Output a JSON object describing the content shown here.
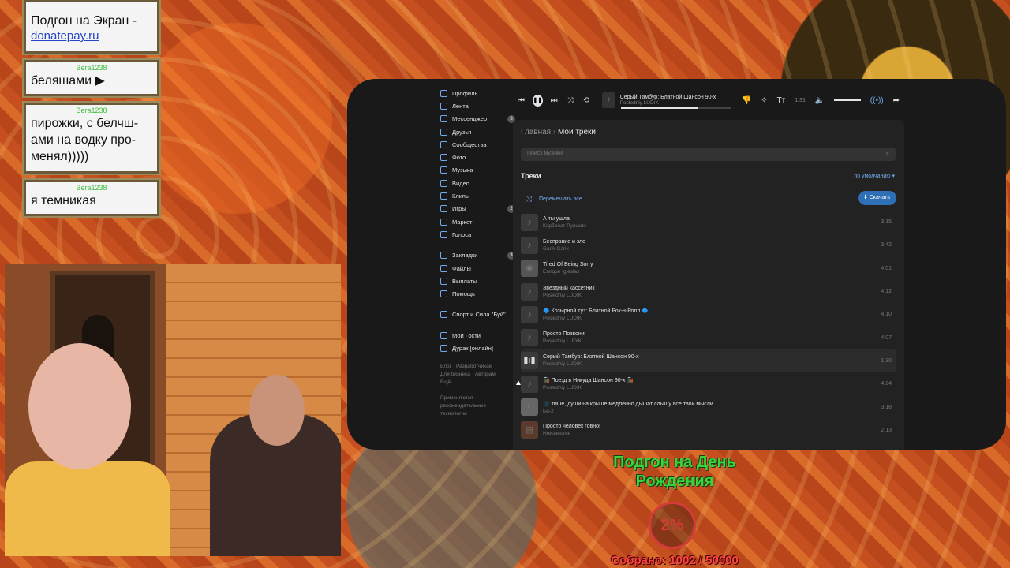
{
  "chat": [
    {
      "author": "",
      "text": "Подгон на Экран -",
      "link": "donatepay.ru"
    },
    {
      "author": "Вега1238",
      "text": "беляшами ▶"
    },
    {
      "author": "Вега1238",
      "text": "пирожки, с белчш-ами на водку про-менял)))))"
    },
    {
      "author": "Вега1238",
      "text": "я темникая"
    }
  ],
  "sidebar": {
    "items": [
      {
        "label": "Профиль"
      },
      {
        "label": "Лента"
      },
      {
        "label": "Мессенджер",
        "count": "3"
      },
      {
        "label": "Друзья"
      },
      {
        "label": "Сообщества"
      },
      {
        "label": "Фото"
      },
      {
        "label": "Музыка"
      },
      {
        "label": "Видео"
      },
      {
        "label": "Клипы"
      },
      {
        "label": "Игры",
        "count": "2"
      },
      {
        "label": "Маркет"
      },
      {
        "label": "Голоса"
      }
    ],
    "items2": [
      {
        "label": "Закладки",
        "count": "3"
      },
      {
        "label": "Файлы"
      },
      {
        "label": "Выплаты"
      },
      {
        "label": "Помощь"
      }
    ],
    "group": "Спорт и Сила \"Буй\"",
    "apps": [
      {
        "label": "Мои Гости"
      },
      {
        "label": "Дурак [онлайн]"
      }
    ],
    "footer": [
      "Блог",
      "Разработчикам",
      "Для бизнеса",
      "Авторам",
      "Ещё"
    ],
    "footer_note": "Применяются рекомендательные технологии"
  },
  "player": {
    "title": "Серый Тамбур: Блатной Шансон 90-х",
    "artist": "Posledniy LUDIK",
    "time": "1:31"
  },
  "main": {
    "crumb_home": "Главная",
    "crumb_current": "Мои треки",
    "search_placeholder": "Поиск музыки",
    "section": "Треки",
    "sort": "по умолчанию",
    "shuffle": "Перемешать все",
    "download": "Скачать"
  },
  "tracks": [
    {
      "title": "А ты ушла",
      "artist": "Карбонат Рулькин",
      "dur": "3:15"
    },
    {
      "title": "Бесправие и зло",
      "artist": "Garik Garik",
      "dur": "3:42"
    },
    {
      "title": "Tired Of Being Sorry",
      "artist": "Enrique Iglesias",
      "dur": "4:01"
    },
    {
      "title": "Звёздный кассетник",
      "artist": "Posledniy LUDIK",
      "dur": "4:12"
    },
    {
      "title": "🔷 Козырной туз: Блатной Рок-н-Ролл 🔷",
      "artist": "Posledniy LUDIK",
      "dur": "4:10"
    },
    {
      "title": "Просто Позвони",
      "artist": "Posledniy LUDIK",
      "dur": "4:07"
    },
    {
      "title": "Серый Тамбур: Блатной Шансон 90-х",
      "artist": "Posledniy LUDIK",
      "dur": "1:30",
      "active": true
    },
    {
      "title": "🚂 Поезд в Никуда Шансон 90-х 🚂",
      "artist": "Posledniy LUDIK",
      "dur": "4:24"
    },
    {
      "title": "🌑 тише, души на крыше медленно дышат слышу все твои мысли",
      "artist": "Би-2",
      "dur": "3:18"
    },
    {
      "title": "Просто человек говно!",
      "artist": "Неизвестен",
      "dur": "2:13"
    }
  ],
  "donation": {
    "goal": "Подгон на День Рождения",
    "percent": "2%",
    "collected": "Собрано: 1002 / 50000"
  }
}
